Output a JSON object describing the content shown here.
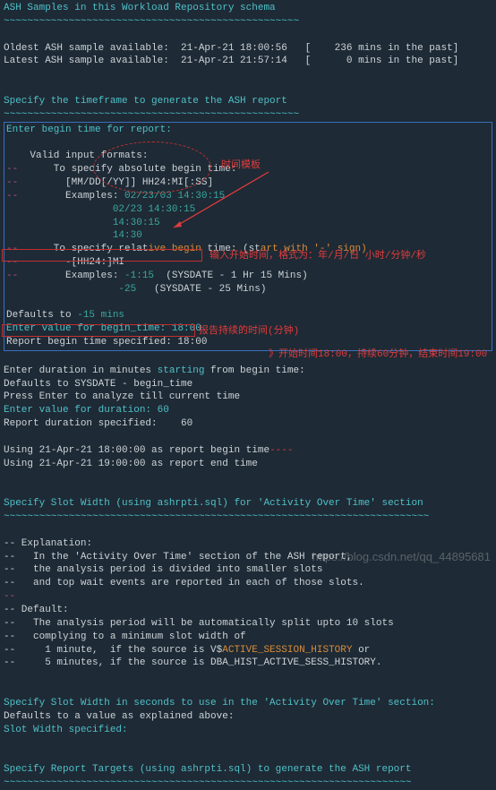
{
  "header": {
    "title": "ASH Samples in this Workload Repository schema",
    "sep": "~~~~~~~~~~~~~~~~~~~~~~~~~~~~~~~~~~~~~~~~~~~~~~~~~~"
  },
  "samples": {
    "oldest": "Oldest ASH sample available:  21-Apr-21 18:00:56   [    236 mins in the past]",
    "latest": "Latest ASH sample available:  21-Apr-21 21:57:14   [      0 mins in the past]"
  },
  "timeframe": {
    "title": "Specify the timeframe to generate the ASH report",
    "sep": "~~~~~~~~~~~~~~~~~~~~~~~~~~~~~~~~~~~~~~~~~~~~~~~~~~"
  },
  "begin": {
    "enter": "Enter begin time for report:",
    "valid": "    Valid input formats:",
    "abs1": "      To specify absolute begin time:",
    "abs2": "        [MM/DD[/YY]] HH24:MI[:SS]",
    "ex_label": "        Examples: ",
    "ex1": "02/23/03 14:30:15",
    "ex2": "                  02/23 14:30:15",
    "ex3": "                  14:30:15",
    "ex4": "                  14:30",
    "rel1_a": "      To specify relat",
    "rel1_b": "ive begin",
    "rel1_c": " time: (st",
    "rel1_d": "art with '-' sign)",
    "rel2": "        -[HH24:]MI",
    "ex2_label": "        Examples: ",
    "rex1a": "-1:15",
    "rex1b": "  (SYSDATE - 1 Hr 15 Mins)",
    "rex2a": "                   -25",
    "rex2b": "   (SYSDATE - 25 Mins)"
  },
  "defaults": {
    "d1a": "Defaults to ",
    "d1b": "-15 mins",
    "d2a": "Enter value for begin_time: ",
    "d2b": "18:00",
    "d3": "Report begin time specified: 18:00"
  },
  "duration": {
    "l1a": "Enter duration in minutes ",
    "l1b": "starting",
    "l1c": " from begin time:",
    "l2": "Defaults to SYSDATE - begin_time",
    "l3": "Press Enter to analyze till current time",
    "l4": "Enter value for duration: 60",
    "l5a": "Report duration specified:   ",
    "l5b": " 60"
  },
  "using": {
    "u1a": "Using 21-Apr-21 18:00:00 as report begin time",
    "u1mid": "----",
    "u2": "Using 21-Apr-21 19:00:00 as report end time"
  },
  "slot1": {
    "title": "Specify Slot Width (using ashrpti.sql) for 'Activity Over Time' section",
    "sep": "~~~~~~~~~~~~~~~~~~~~~~~~~~~~~~~~~~~~~~~~~~~~~~~~~~~~~~~~~~~~~~~~~~~~~~~~"
  },
  "explain": {
    "e1": "-- Explanation:",
    "e2": "--   In the 'Activity Over Time' section of the ASH report,",
    "e3": "--   the analysis period is divided into smaller slots",
    "e4": "--   and top wait events are reported in each of those slots.",
    "dash": "--",
    "d1": "-- Default:",
    "d2": "--   The analysis period will be automatically split upto 10 slots",
    "d3": "--   complying to a minimum slot width of",
    "d4a": "--     1 minute,  if the source is V$",
    "d4b": "ACTIVE_SESSION_HISTORY",
    "d4c": " or",
    "d5": "--     5 minutes, if the source is DBA_HIST_ACTIVE_SESS_HISTORY."
  },
  "slot2": {
    "t1": "Specify Slot Width in seconds to use in the 'Activity Over Time' section:",
    "t2": "Defaults to a value as explained above:",
    "t3": "Slot Width specified:"
  },
  "targets": {
    "t1": "Specify Report Targets (using ashrpti.sql) to generate the ASH report",
    "sep": "~~~~~~~~~~~~~~~~~~~~~~~~~~~~~~~~~~~~~~~~~~~~~~~~~~~~~~~~~~~~~~~~~~~~~"
  },
  "annotations": {
    "template": "时间模板",
    "input_begin": "输入开始时间，格式为：年/月/日  小时/分钟/秒",
    "duration": "报告持续的时间(分钟)",
    "summary": "》开始时间18:00，持续60分钟，结束时间19:00"
  },
  "watermark": "https://blog.csdn.net/qq_44895681"
}
